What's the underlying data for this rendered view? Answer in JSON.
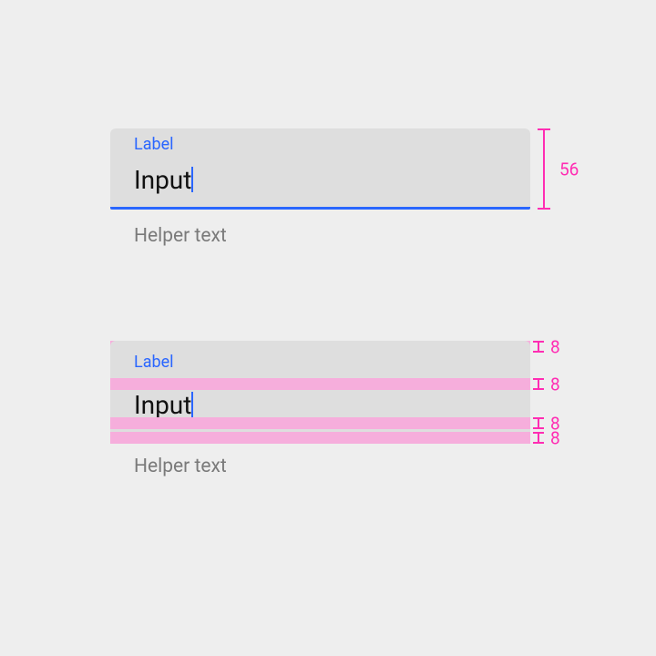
{
  "field1": {
    "label": "Label",
    "value": "Input",
    "helper": "Helper text",
    "height": "56"
  },
  "field2": {
    "label": "Label",
    "value": "Input",
    "helper": "Helper text",
    "pad_top": "8",
    "pad_label_bottom": "8",
    "pad_input_bottom": "8",
    "pad_helper_top": "8"
  }
}
